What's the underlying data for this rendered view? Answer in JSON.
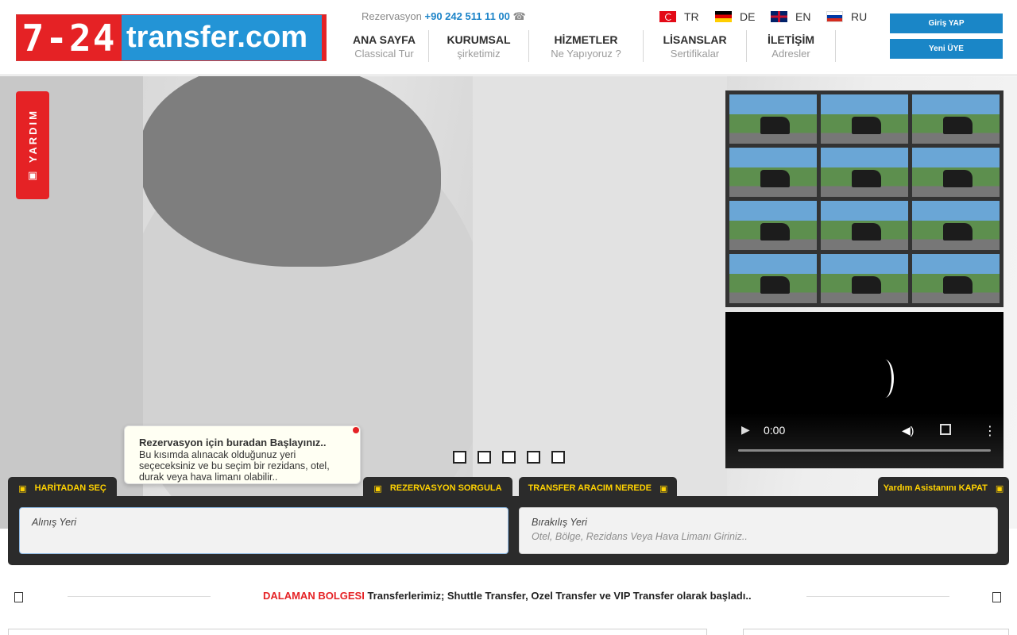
{
  "header": {
    "logo_left": "7-24",
    "logo_right": "transfer.com",
    "reservation_label": "Rezervasyon",
    "phone": "+90 242 511 11 00",
    "phone_icon": "phone-icon",
    "nav": [
      {
        "label": "ANA SAYFA",
        "sub": "Classical Tur"
      },
      {
        "label": "KURUMSAL",
        "sub": "şirketimiz"
      },
      {
        "label": "HİZMETLER",
        "sub": "Ne Yapıyoruz ?"
      },
      {
        "label": "LİSANSLAR",
        "sub": "Sertifikalar"
      },
      {
        "label": "İLETİŞİM",
        "sub": "Adresler"
      }
    ],
    "languages": [
      "TR",
      "DE",
      "EN",
      "RU"
    ],
    "login_label": "Giriş YAP",
    "register_label": "Yeni ÜYE"
  },
  "help_tab": {
    "label": "YARDIM",
    "icon": "help-icon"
  },
  "gallery": {
    "thumb_count": 12
  },
  "video": {
    "time": "0:00"
  },
  "tooltip": {
    "title": "Rezervasyon için buradan Başlayınız..",
    "body": "Bu kısımda alınacak olduğunuz yeri seçeceksiniz ve bu seçim bir rezidans, otel, durak veya hava limanı olabilir.."
  },
  "tabs": {
    "map": "HARİTADAN SEÇ",
    "query": "REZERVASYON SORGULA",
    "where": "TRANSFER ARACIM NEREDE",
    "assistant": "Yardım Asistanını KAPAT"
  },
  "inputs": {
    "pickup_label": "Alınış Yeri",
    "dropoff_label": "Bırakılış Yeri",
    "dropoff_placeholder": "Otel, Bölge, Rezidans Veya Hava Limanı Giriniz.."
  },
  "notice": {
    "region": "DALAMAN BOLGESI",
    "text": " Transferlerimiz; Shuttle Transfer, Ozel Transfer ve VIP Transfer olarak başladı.."
  },
  "colors": {
    "brand_red": "#e52225",
    "brand_blue": "#1a86c7",
    "tab_yellow": "#ffd200"
  }
}
